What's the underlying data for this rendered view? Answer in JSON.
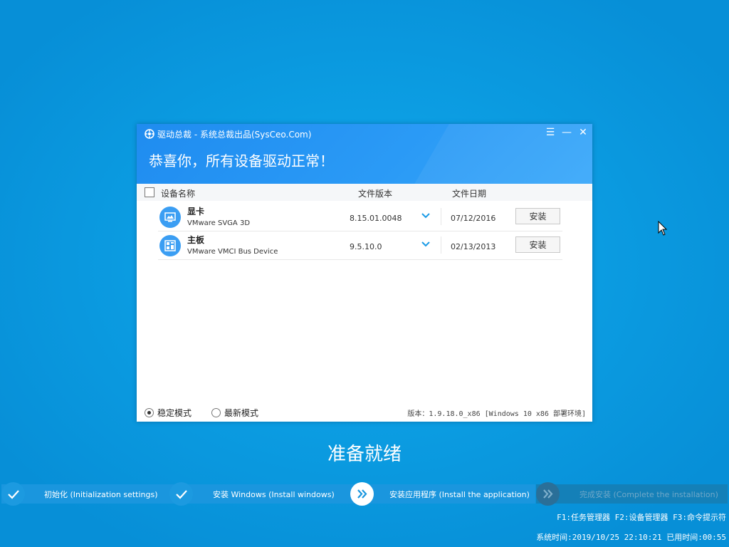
{
  "window": {
    "title": "驱动总裁 - 系统总裁出品(SysCeo.Com)",
    "headline": "恭喜你，所有设备驱动正常！",
    "controls": {
      "menu": "☰",
      "minimize": "—",
      "close": "✕"
    }
  },
  "table": {
    "headers": {
      "name": "设备名称",
      "version": "文件版本",
      "date": "文件日期"
    },
    "rows": [
      {
        "name": "显卡",
        "device": "VMware SVGA 3D",
        "version": "8.15.01.0048",
        "date": "07/12/2016",
        "action": "安装",
        "icon": "display-icon"
      },
      {
        "name": "主板",
        "device": "VMware VMCI Bus Device",
        "version": "9.5.10.0",
        "date": "02/13/2013",
        "action": "安装",
        "icon": "motherboard-icon"
      }
    ]
  },
  "footer": {
    "mode_stable": "稳定模式",
    "mode_latest": "最新模式",
    "version_text": "版本：1.9.18.0_x86 [Windows 10 x86 部署环境]"
  },
  "status_text": "准备就绪",
  "steps": [
    {
      "label": "初始化 (Initialization settings)",
      "state": "done"
    },
    {
      "label": "安装 Windows (Install windows)",
      "state": "done"
    },
    {
      "label": "安装应用程序 (Install the application)",
      "state": "active"
    },
    {
      "label": "完成安装 (Complete the installation)",
      "state": "pending"
    }
  ],
  "hotkeys": "F1:任务管理器 F2:设备管理器 F3:命令提示符",
  "clock": "系统时间:2019/10/25 22:10:21 已用时间:00:55",
  "colors": {
    "accent": "#2b9bf6",
    "background": "#0c9ee3",
    "step_bar": "#1a96de"
  }
}
